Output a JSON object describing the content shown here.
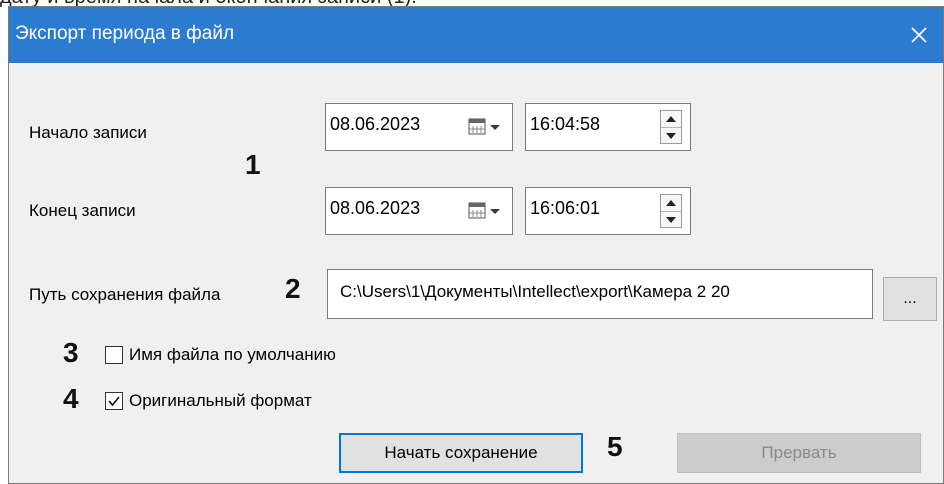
{
  "document_fragment": "дату и время начала и окончания записи (1).",
  "dialog": {
    "title": "Экспорт периода в файл",
    "close_glyph": "✕",
    "colors": {
      "titlebar": "#2b7bd1",
      "primary_border": "#0078d7"
    }
  },
  "start": {
    "label": "Начало записи",
    "date": "08.06.2023",
    "time": "16:04:58"
  },
  "end": {
    "label": "Конец записи",
    "date": "08.06.2023",
    "time": "16:06:01"
  },
  "path": {
    "label": "Путь сохранения файла",
    "value": "C:\\Users\\1\\Документы\\Intellect\\export\\Камера 2 20",
    "browse_label": "..."
  },
  "checkboxes": [
    {
      "label": "Имя файла по умолчанию",
      "checked": false
    },
    {
      "label": "Оригинальный формат",
      "checked": true
    }
  ],
  "numbers": [
    "1",
    "2",
    "3",
    "4",
    "5"
  ],
  "buttons": {
    "start_save": "Начать сохранение",
    "abort": "Прервать"
  },
  "icons": {
    "calendar": "calendar-icon",
    "spin_up": "arrow-up-icon",
    "spin_down": "arrow-down-icon",
    "checkmark": "checkmark-icon"
  }
}
